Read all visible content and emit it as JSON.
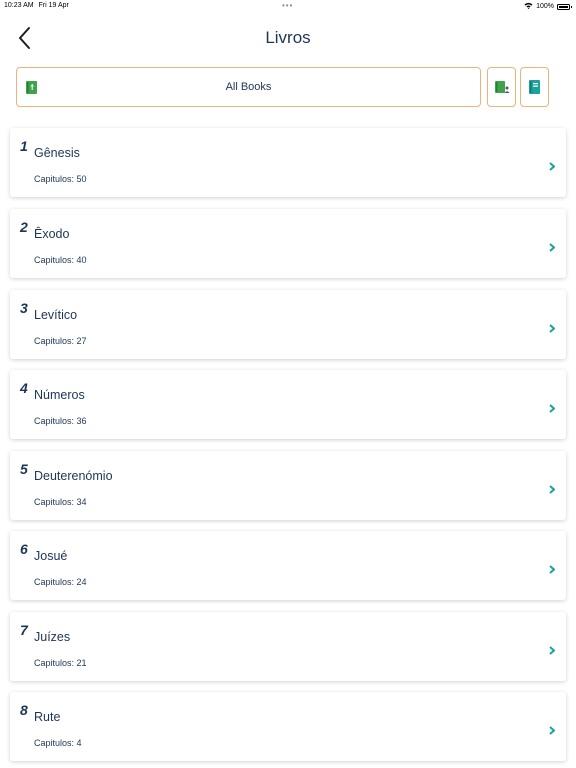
{
  "status": {
    "time": "10:23 AM",
    "date": "Fri 19 Apr",
    "dots": "•••",
    "battery": "100%"
  },
  "header": {
    "title": "Livros",
    "back_icon": "chevron-left-icon"
  },
  "filter": {
    "label": "All Books",
    "icon": "book-icon",
    "buttons": [
      "book-person-icon",
      "book-icon"
    ]
  },
  "colors": {
    "accent_border": "#f0b27a",
    "book_green": "#3fa34d",
    "chevron_teal": "#1aa39a",
    "text_navy": "#1d3557"
  },
  "books": [
    {
      "num": "1",
      "name": "Gênesis",
      "chapters": "Capitulos: 50"
    },
    {
      "num": "2",
      "name": "Êxodo",
      "chapters": "Capitulos: 40"
    },
    {
      "num": "3",
      "name": "Levítico",
      "chapters": "Capitulos: 27"
    },
    {
      "num": "4",
      "name": "Números",
      "chapters": "Capitulos: 36"
    },
    {
      "num": "5",
      "name": "Deuterenómio",
      "chapters": "Capitulos: 34"
    },
    {
      "num": "6",
      "name": "Josué",
      "chapters": "Capitulos: 24"
    },
    {
      "num": "7",
      "name": "Juízes",
      "chapters": "Capitulos: 21"
    },
    {
      "num": "8",
      "name": "Rute",
      "chapters": "Capitulos: 4"
    }
  ]
}
